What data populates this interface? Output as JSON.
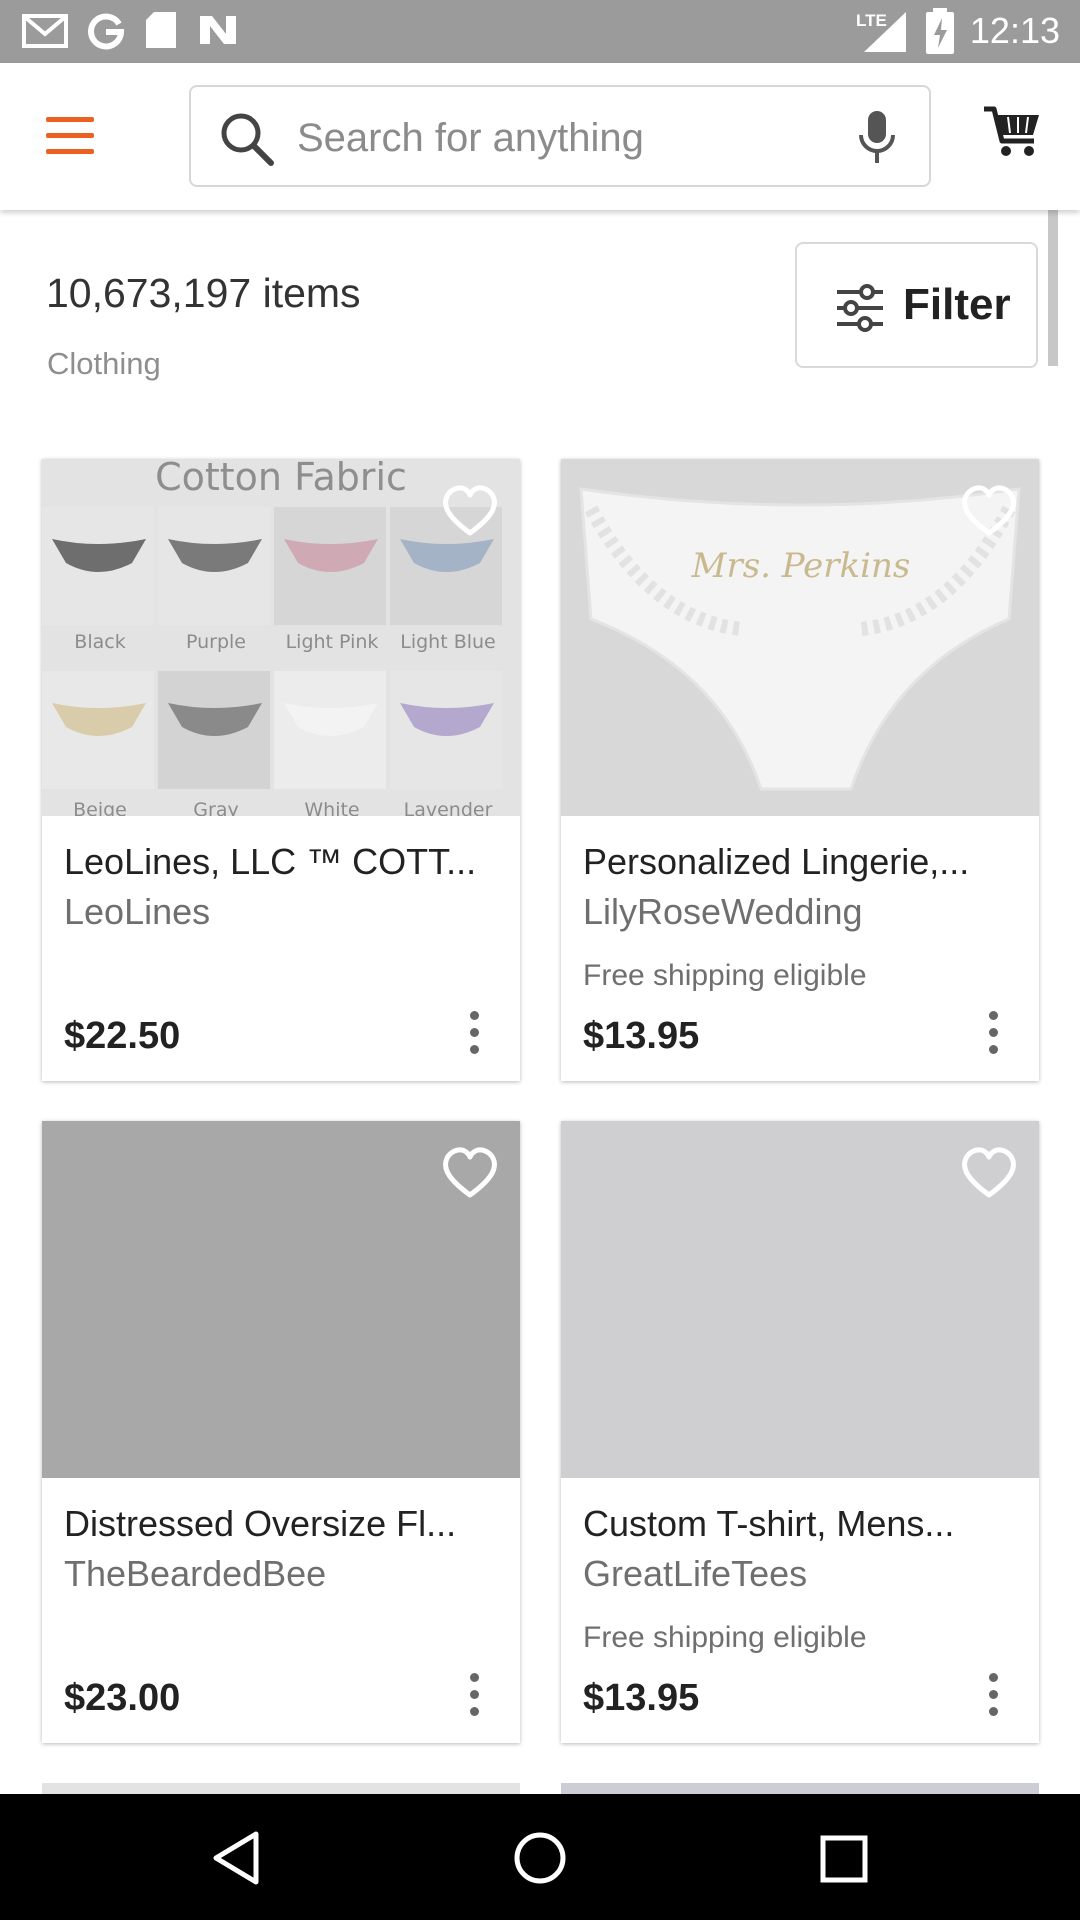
{
  "status_bar": {
    "time": "12:13",
    "network_label": "LTE",
    "icons": [
      "gmail-icon",
      "google-icon",
      "sd-card-icon",
      "n-icon",
      "signal-icon",
      "battery-charging-icon"
    ]
  },
  "top_bar": {
    "search_placeholder": "Search for anything",
    "accent_color": "#ea6120"
  },
  "results": {
    "count": "10,673,197 items",
    "category": "Clothing",
    "filter_label": "Filter"
  },
  "listings": [
    {
      "title": "LeoLines, LLC ™ COTT...",
      "shop": "LeoLines",
      "shipping": "",
      "price": "$22.50",
      "image": {
        "heading": "Cotton Fabric",
        "swatches": [
          "Black",
          "Purple",
          "Light Pink",
          "Light Blue",
          "Beige",
          "Gray",
          "White",
          "Lavender"
        ]
      }
    },
    {
      "title": "Personalized Lingerie,...",
      "shop": "LilyRoseWedding",
      "shipping": "Free shipping eligible",
      "price": "$13.95",
      "image": {
        "script_text": "Mrs. Perkins"
      }
    },
    {
      "title": "Distressed Oversize Fl...",
      "shop": "TheBeardedBee",
      "shipping": "",
      "price": "$23.00",
      "image": {
        "color": "#a8a8a8"
      }
    },
    {
      "title": "Custom T-shirt, Mens...",
      "shop": "GreatLifeTees",
      "shipping": "Free shipping eligible",
      "price": "$13.95",
      "image": {
        "color": "#cfcfd1"
      }
    }
  ],
  "nav_bar": {
    "buttons": [
      "back-icon",
      "home-icon",
      "recents-icon"
    ]
  }
}
